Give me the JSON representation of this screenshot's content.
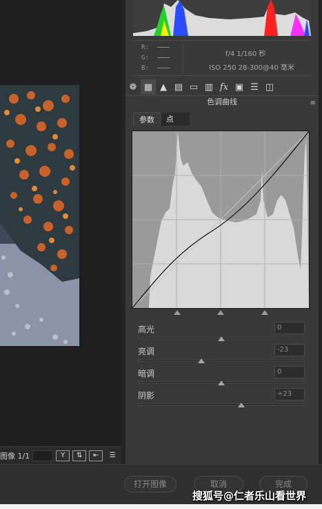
{
  "camera_info": {
    "r_label": "R:",
    "g_label": "G:",
    "b_label": "B:",
    "aperture_shutter": "f/4   1/160 秒",
    "iso_lens": "ISO 250   28-300@40 毫米"
  },
  "toolbar": {
    "icons": [
      "aperture-icon",
      "curve-grid-icon",
      "mountains-icon",
      "hsl-icon",
      "split-toning-icon",
      "detail-icon",
      "fx-icon",
      "camera-calibration-icon",
      "presets-icon",
      "snapshots-icon"
    ],
    "section_title": "色调曲线",
    "menu_glyph": "≡"
  },
  "tabs": {
    "parametric": "参数",
    "point": "点"
  },
  "sliders": [
    {
      "label": "高光",
      "value": "0",
      "level": 0.5
    },
    {
      "label": "亮调",
      "value": "-23",
      "level": 0.38
    },
    {
      "label": "暗调",
      "value": "0",
      "level": 0.5
    },
    {
      "label": "阴影",
      "value": "+23",
      "level": 0.62
    }
  ],
  "status": {
    "image_label": "图像 1/1",
    "btn_y": "Y",
    "btn_swap": "⇅",
    "btn_copy": "⇤",
    "btn_settings": "☰"
  },
  "buttons": {
    "open_image": "打开图像",
    "cancel": "取消",
    "done": "完成"
  },
  "watermark": "搜狐号@仁者乐山看世界",
  "colors": {
    "panel_bg": "#383838",
    "curve_bg": "#9a9a9a",
    "histogram_fill": "#dcdcdc"
  }
}
